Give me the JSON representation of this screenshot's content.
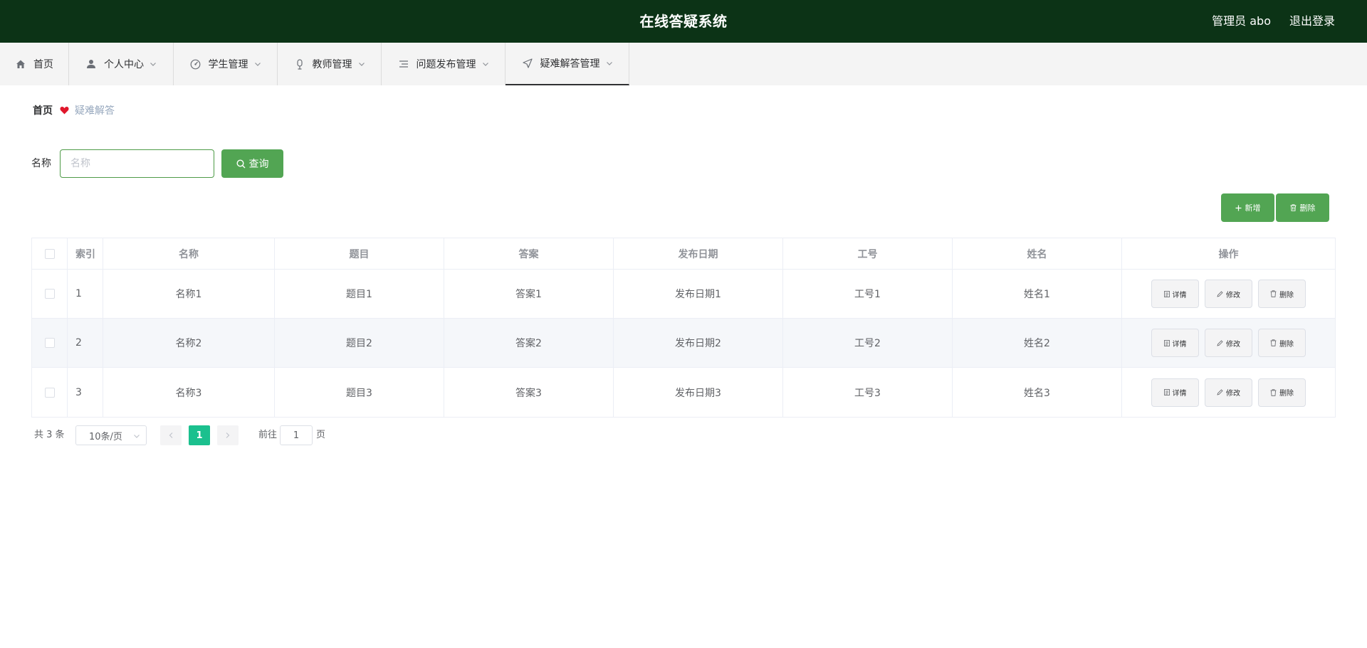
{
  "header": {
    "title": "在线答疑系统",
    "user": "管理员 abo",
    "logout": "退出登录",
    "bg_color": "#0c3316"
  },
  "nav": {
    "items": [
      {
        "label": "首页",
        "icon": "home-icon"
      },
      {
        "label": "个人中心",
        "icon": "user-icon"
      },
      {
        "label": "学生管理",
        "icon": "gauge-icon"
      },
      {
        "label": "教师管理",
        "icon": "microphone-icon"
      },
      {
        "label": "问题发布管理",
        "icon": "list-icon"
      },
      {
        "label": "疑难解答管理",
        "icon": "send-icon"
      }
    ],
    "active_index": 5
  },
  "breadcrumb": {
    "home": "首页",
    "current": "疑难解答"
  },
  "search": {
    "label": "名称",
    "placeholder": "名称",
    "value": "",
    "button": "查询"
  },
  "actions": {
    "add": "新增",
    "delete": "删除"
  },
  "table": {
    "columns": [
      "索引",
      "名称",
      "题目",
      "答案",
      "发布日期",
      "工号",
      "姓名",
      "操作"
    ],
    "rows": [
      {
        "index": "1",
        "name": "名称1",
        "question": "题目1",
        "answer": "答案1",
        "date": "发布日期1",
        "id": "工号1",
        "person": "姓名1"
      },
      {
        "index": "2",
        "name": "名称2",
        "question": "题目2",
        "answer": "答案2",
        "date": "发布日期2",
        "id": "工号2",
        "person": "姓名2"
      },
      {
        "index": "3",
        "name": "名称3",
        "question": "题目3",
        "answer": "答案3",
        "date": "发布日期3",
        "id": "工号3",
        "person": "姓名3"
      }
    ],
    "row_actions": {
      "detail": "详情",
      "edit": "修改",
      "delete": "删除"
    }
  },
  "pagination": {
    "total": "共 3 条",
    "page_size": "10条/页",
    "current_page": "1",
    "goto_label": "前往",
    "goto_value": "1",
    "page_unit": "页"
  },
  "colors": {
    "accent_green": "#52a553",
    "page_active": "#1bc08e",
    "heart": "#e0162b"
  }
}
